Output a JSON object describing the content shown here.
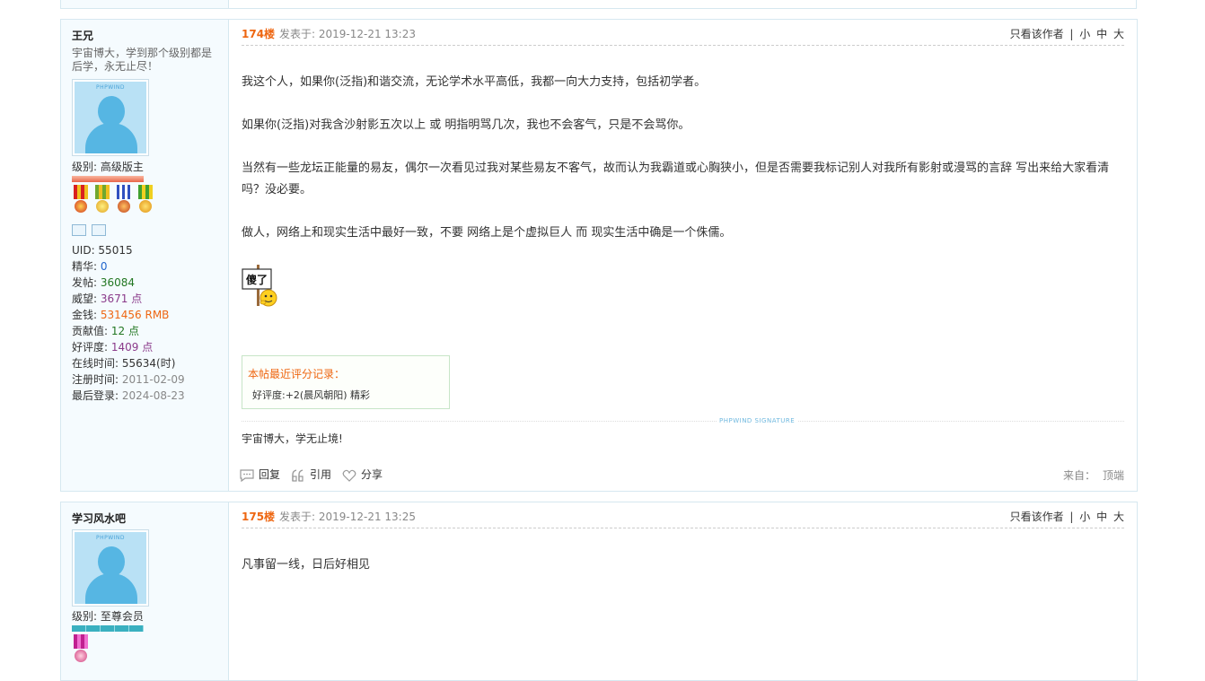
{
  "posts": [
    {
      "author": "王兄",
      "motto": "宇宙博大，学到那个级别都是后学，永无止尽！",
      "avatar_label": "PHPWIND",
      "level_label": "级别: 高级版主",
      "level_bar_color": "#f08060",
      "stats": [
        {
          "key": "UID: ",
          "value": "55015",
          "color": "#333333"
        },
        {
          "key": "精华: ",
          "value": "0",
          "color": "#2266cc"
        },
        {
          "key": "发帖: ",
          "value": "36084",
          "color": "#227722"
        },
        {
          "key": "威望: ",
          "value": "3671 点",
          "color": "#8a3a8a"
        },
        {
          "key": "金钱: ",
          "value": "531456 RMB",
          "color": "#ee6611"
        },
        {
          "key": "贡献值: ",
          "value": "12 点",
          "color": "#227722"
        },
        {
          "key": "好评度: ",
          "value": "1409 点",
          "color": "#8a3a8a"
        },
        {
          "key": "在线时间: ",
          "value": "55634(时)",
          "color": "#333333"
        },
        {
          "key": "注册时间: ",
          "value": "2011-02-09",
          "color": "#888888"
        },
        {
          "key": "最后登录: ",
          "value": "2024-08-23",
          "color": "#888888"
        }
      ],
      "floor": "174楼",
      "time": "发表于: 2019-12-21 13:23",
      "content": [
        "我这个人，如果你(泛指)和谐交流，无论学术水平高低，我都一向大力支持，包括初学者。",
        "如果你(泛指)对我含沙射影五次以上 或  明指明骂几次，我也不会客气，只是不会骂你。",
        "当然有一些龙坛正能量的易友，偶尔一次看见过我对某些易友不客气，故而认为我霸道或心胸狭小，但是否需要我标记别人对我所有影射或漫骂的言辞  写出来给大家看清吗？没必要。",
        "做人，网络上和现实生活中最好一致，不要 网络上是个虚拟巨人 而 现实生活中确是一个侏儒。"
      ],
      "emoticon_text": "傻了",
      "rating_title": "本帖最近评分记录：",
      "rating_value": "好评度:+2(晨风朝阳) 精彩",
      "signature_label": "PHPWIND SIGNATURE",
      "signature": "宇宙博大，学无止境!"
    },
    {
      "author": "学习风水吧",
      "avatar_label": "PHPWIND",
      "level_label": "级别: 至尊会员",
      "level_bar_color": "#3ab0c0",
      "floor": "175楼",
      "time": "发表于: 2019-12-21 13:25",
      "content": [
        "凡事留一线，日后好相见"
      ]
    }
  ],
  "header_links": {
    "only_author": "只看该作者",
    "sep": "|",
    "font_small": "小",
    "font_medium": "中",
    "font_large": "大"
  },
  "actions": {
    "reply": "回复",
    "quote": "引用",
    "share": "分享",
    "from": "来自：",
    "top": "顶端"
  },
  "icons": [
    "reply-icon",
    "quote-icon",
    "share-heart-icon",
    "profile-card-icon",
    "mail-icon",
    "medal-icon"
  ]
}
